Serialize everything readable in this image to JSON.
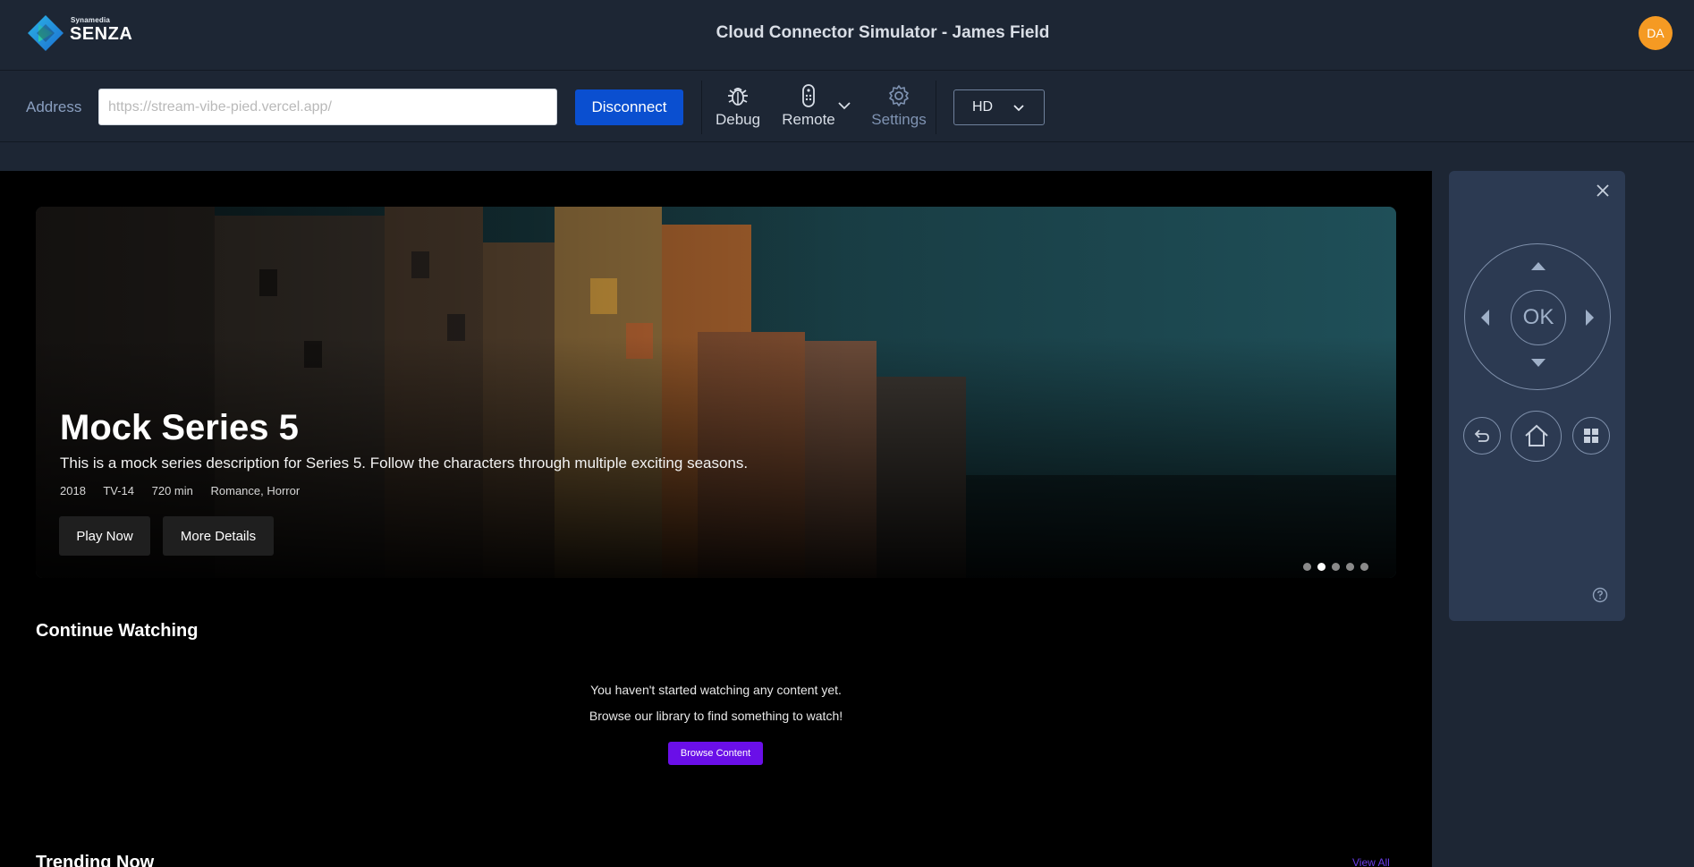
{
  "header": {
    "logo_sub": "Synamedia",
    "logo_brand": "SENZA",
    "title": "Cloud Connector Simulator - James Field",
    "avatar_initials": "DA"
  },
  "toolbar": {
    "address_label": "Address",
    "address_placeholder": "https://stream-vibe-pied.vercel.app/",
    "disconnect_label": "Disconnect",
    "debug_label": "Debug",
    "remote_label": "Remote",
    "settings_label": "Settings",
    "quality_value": "HD"
  },
  "hero": {
    "title": "Mock Series 5",
    "description": "This is a mock series description for Series 5. Follow the characters through multiple exciting seasons.",
    "year": "2018",
    "rating": "TV-14",
    "duration": "720 min",
    "genres": "Romance, Horror",
    "play_label": "Play Now",
    "details_label": "More Details",
    "slide_count": 5,
    "active_slide": 2
  },
  "continue_watching": {
    "title": "Continue Watching",
    "empty_line1": "You haven't started watching any content yet.",
    "empty_line2": "Browse our library to find something to watch!",
    "browse_label": "Browse Content"
  },
  "trending": {
    "title": "Trending Now",
    "view_all": "View All"
  },
  "remote": {
    "ok_label": "OK"
  },
  "colors": {
    "chrome_bg": "#1d2634",
    "primary_button": "#0a4fd0",
    "accent_purple": "#6a0fe8",
    "avatar": "#f59a23",
    "remote_panel": "#2c3a52"
  }
}
